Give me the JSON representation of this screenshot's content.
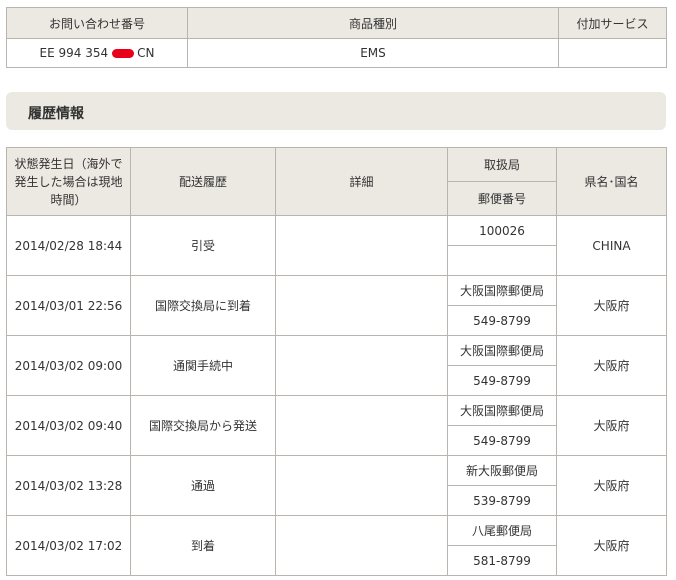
{
  "summary": {
    "headers": [
      "お問い合わせ番号",
      "商品種別",
      "付加サービス"
    ],
    "tracking_prefix": "EE 994 354",
    "tracking_suffix": "CN",
    "item_type": "EMS",
    "additional_service": ""
  },
  "section": {
    "title": "履歴情報"
  },
  "history": {
    "headers": {
      "date": "状態発生日（海外で発生した場合は現地時間）",
      "status": "配送履歴",
      "detail": "詳細",
      "office": "取扱局",
      "postal": "郵便番号",
      "region": "県名･国名"
    },
    "rows": [
      {
        "date": "2014/02/28 18:44",
        "status": "引受",
        "detail": "",
        "office": "100026",
        "postal": "",
        "region": "CHINA"
      },
      {
        "date": "2014/03/01 22:56",
        "status": "国際交換局に到着",
        "detail": "",
        "office": "大阪国際郵便局",
        "postal": "549-8799",
        "region": "大阪府"
      },
      {
        "date": "2014/03/02 09:00",
        "status": "通関手続中",
        "detail": "",
        "office": "大阪国際郵便局",
        "postal": "549-8799",
        "region": "大阪府"
      },
      {
        "date": "2014/03/02 09:40",
        "status": "国際交換局から発送",
        "detail": "",
        "office": "大阪国際郵便局",
        "postal": "549-8799",
        "region": "大阪府"
      },
      {
        "date": "2014/03/02 13:28",
        "status": "通過",
        "detail": "",
        "office": "新大阪郵便局",
        "postal": "539-8799",
        "region": "大阪府"
      },
      {
        "date": "2014/03/02 17:02",
        "status": "到着",
        "detail": "",
        "office": "八尾郵便局",
        "postal": "581-8799",
        "region": "大阪府"
      }
    ]
  }
}
